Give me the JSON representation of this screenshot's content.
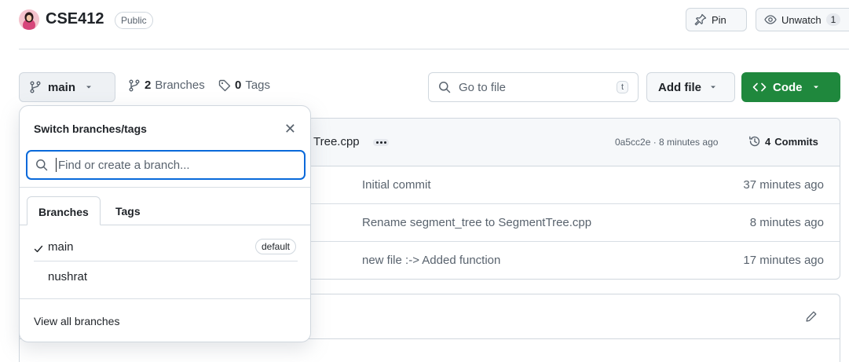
{
  "repo": {
    "name": "CSE412",
    "visibility": "Public"
  },
  "actions": {
    "pin_label": "Pin",
    "watch_label": "Unwatch",
    "watch_count": "1"
  },
  "toolbar": {
    "branch": "main",
    "branches_count": "2",
    "branches_label": "Branches",
    "tags_count": "0",
    "tags_label": "Tags",
    "goto_placeholder": "Go to file",
    "goto_shortcut": "t",
    "add_file_label": "Add file",
    "code_label": "Code"
  },
  "latest_commit": {
    "file_fragment": "Tree.cpp",
    "sha_time": "0a5cc2e · 8 minutes ago",
    "commits_count": "4",
    "commits_label": "Commits"
  },
  "files": [
    {
      "message": "Initial commit",
      "time": "37 minutes ago"
    },
    {
      "message": "Rename segment_tree to SegmentTree.cpp",
      "time": "8 minutes ago"
    },
    {
      "message": "new file :-> Added function",
      "time": "17 minutes ago"
    }
  ],
  "branch_menu": {
    "title": "Switch branches/tags",
    "search_placeholder": "Find or create a branch...",
    "tabs": [
      "Branches",
      "Tags"
    ],
    "items": [
      {
        "name": "main",
        "badge": "default",
        "selected": true
      },
      {
        "name": "nushrat"
      }
    ],
    "footer": "View all branches"
  },
  "colors": {
    "primary_green": "#1f883d",
    "focus_blue": "#0969da",
    "border": "#d0d7de",
    "muted_text": "#59636e"
  }
}
